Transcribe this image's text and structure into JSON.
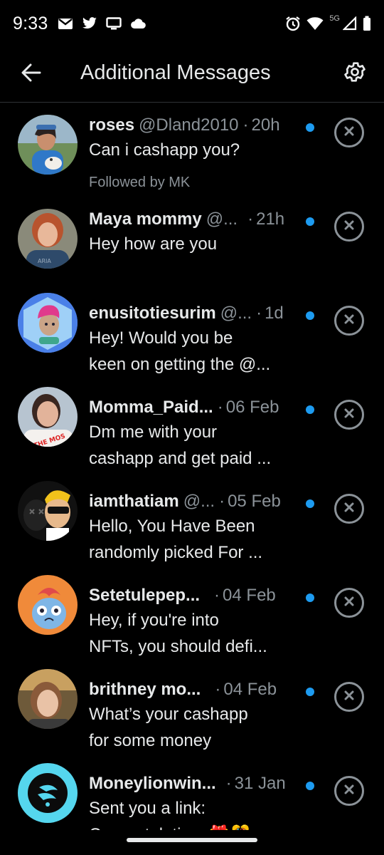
{
  "status_bar": {
    "time": "9:33",
    "network_label": "5G",
    "left_icons": [
      "gmail-icon",
      "twitter-icon",
      "cast-icon",
      "cloud-icon"
    ],
    "right_icons": [
      "alarm-icon",
      "wifi-icon",
      "signal-icon",
      "battery-icon"
    ]
  },
  "header": {
    "title": "Additional Messages",
    "back_icon": "back-arrow-icon",
    "settings_icon": "gear-icon"
  },
  "accent_color": "#1d9bf0",
  "messages": [
    {
      "name": "roses",
      "handle": "@Dland2010",
      "time": "20h",
      "text": [
        "Can i cashapp you?"
      ],
      "followed_by": "Followed by MK",
      "unread": true,
      "avatar": "woman-with-dog"
    },
    {
      "name": "Maya mommy",
      "handle": "@...",
      "time": "21h",
      "text": [
        "Hey how are you"
      ],
      "unread": true,
      "avatar": "woman-red-hair"
    },
    {
      "name": "enusitotiesurim",
      "handle": "@...",
      "time": "1d",
      "text": [
        "Hey! Would you be",
        "keen on getting the @..."
      ],
      "unread": true,
      "avatar": "3d-avatar-pink-hair"
    },
    {
      "name": "Momma_Paid...",
      "handle": "",
      "time": "06 Feb",
      "text": [
        "Dm me with your",
        "cashapp and get paid ..."
      ],
      "unread": true,
      "avatar": "woman-selfie"
    },
    {
      "name": "iamthatiam",
      "handle": "@...",
      "time": "05 Feb",
      "text": [
        "Hello, You Have Been",
        "randomly picked For ..."
      ],
      "unread": true,
      "avatar": "cartoon-bored-ape"
    },
    {
      "name": "Setetulepep...",
      "handle": "",
      "time": "04 Feb",
      "text": [
        "Hey, if you're into",
        "NFTs, you should defi..."
      ],
      "unread": true,
      "avatar": "cartoon-cat-nft"
    },
    {
      "name": "brithney mo...",
      "handle": "",
      "time": "04 Feb",
      "text": [
        "What’s your cashapp",
        "for some money"
      ],
      "unread": true,
      "avatar": "woman-outdoors"
    },
    {
      "name": "Moneylionwin...",
      "handle": "",
      "time": "31 Jan",
      "text": [
        "Sent you a link:",
        "Congratulations🎁🎊 ..."
      ],
      "unread": true,
      "avatar": "moneylion-logo"
    }
  ]
}
